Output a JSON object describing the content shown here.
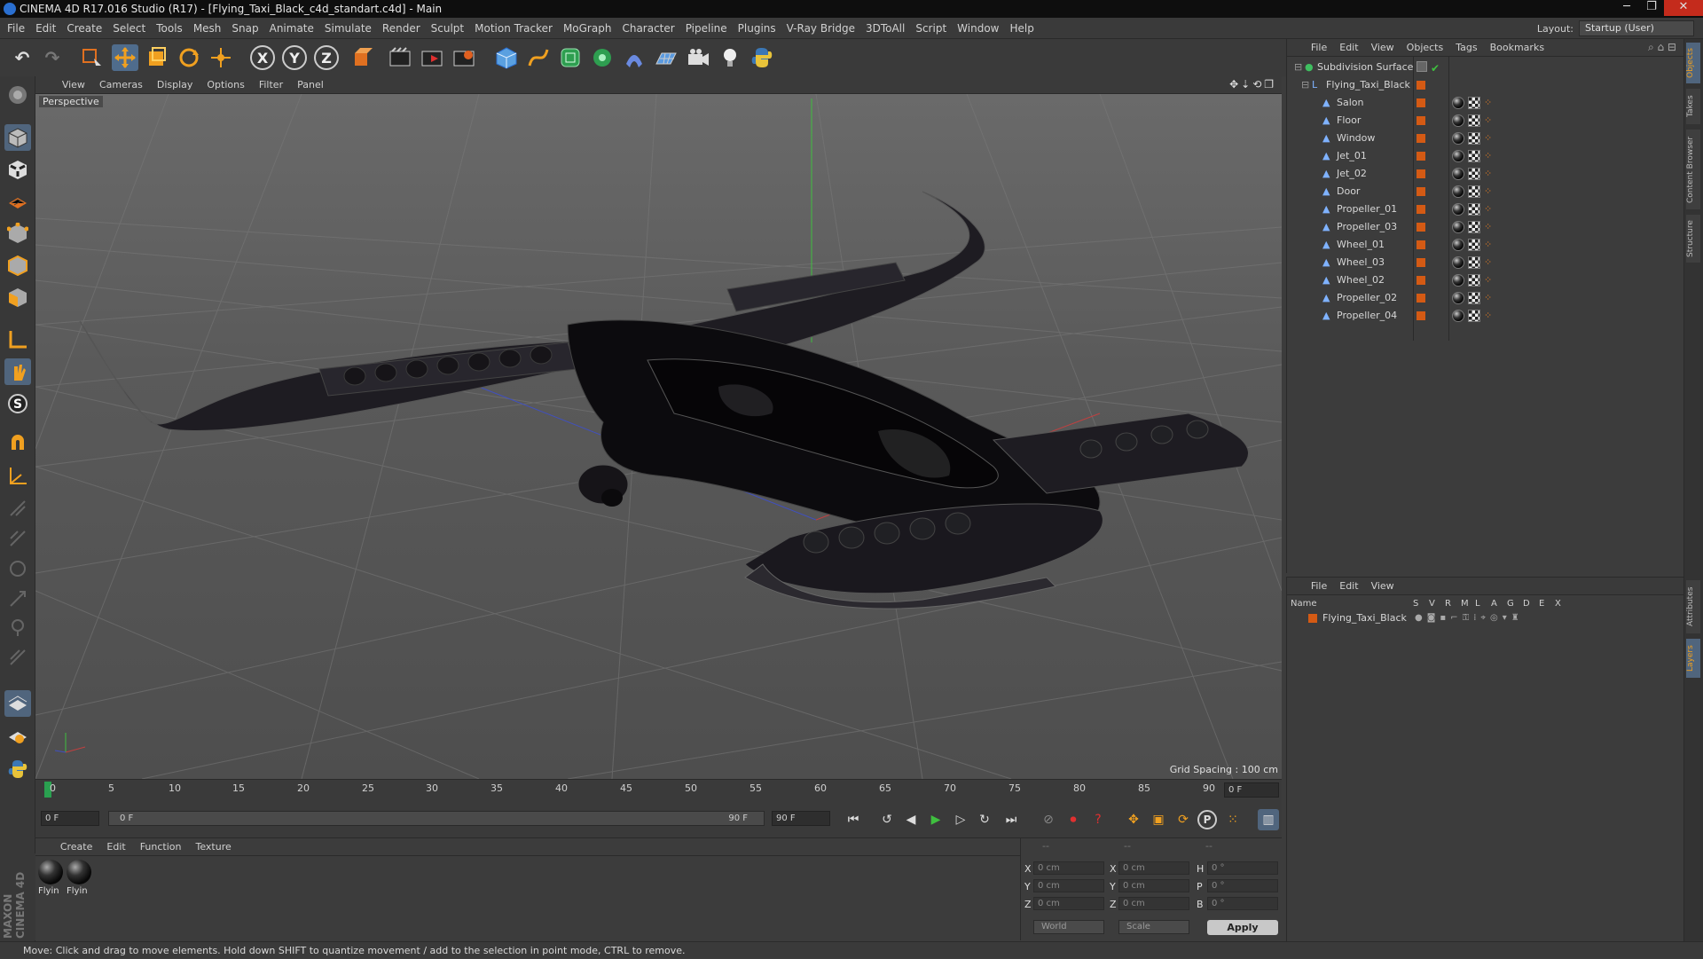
{
  "window": {
    "title": "CINEMA 4D R17.016 Studio (R17) - [Flying_Taxi_Black_c4d_standart.c4d] - Main",
    "controls": [
      "─",
      "❐",
      "✕"
    ]
  },
  "menubar": {
    "items": [
      "File",
      "Edit",
      "Create",
      "Select",
      "Tools",
      "Mesh",
      "Snap",
      "Animate",
      "Simulate",
      "Render",
      "Sculpt",
      "Motion Tracker",
      "MoGraph",
      "Character",
      "Pipeline",
      "Plugins",
      "V-Ray Bridge",
      "3DToAll",
      "Script",
      "Window",
      "Help"
    ],
    "layout_label": "Layout:",
    "layout_value": "Startup (User)"
  },
  "toolbar": {
    "axis_x": "X",
    "axis_y": "Y",
    "axis_z": "Z"
  },
  "viewport": {
    "menu": [
      "View",
      "Cameras",
      "Display",
      "Options",
      "Filter",
      "Panel"
    ],
    "label": "Perspective",
    "grid_spacing": "Grid Spacing : 100 cm"
  },
  "timeline": {
    "ticks": [
      "0",
      "5",
      "10",
      "15",
      "20",
      "25",
      "30",
      "35",
      "40",
      "45",
      "50",
      "55",
      "60",
      "65",
      "70",
      "75",
      "80",
      "85",
      "90"
    ],
    "end_frame_display": "0 F",
    "current_frame": "0 F",
    "range_start": "0 F",
    "range_end": "90 F",
    "max_frame": "90 F"
  },
  "material_manager": {
    "menu": [
      "Create",
      "Edit",
      "Function",
      "Texture"
    ],
    "materials": [
      "Flyin",
      "Flyin"
    ]
  },
  "coordinates": {
    "headers": [
      "--",
      "--",
      "--"
    ],
    "rows": [
      {
        "pos_label": "X",
        "pos": "0 cm",
        "size_label": "X",
        "size": "0 cm",
        "rot_label": "H",
        "rot": "0 °"
      },
      {
        "pos_label": "Y",
        "pos": "0 cm",
        "size_label": "Y",
        "size": "0 cm",
        "rot_label": "P",
        "rot": "0 °"
      },
      {
        "pos_label": "Z",
        "pos": "0 cm",
        "size_label": "Z",
        "size": "0 cm",
        "rot_label": "B",
        "rot": "0 °"
      }
    ],
    "mode": "World",
    "type": "Scale",
    "apply": "Apply"
  },
  "object_manager": {
    "menu": [
      "File",
      "Edit",
      "View",
      "Objects",
      "Tags",
      "Bookmarks"
    ],
    "root": "Subdivision Surface",
    "group": "Flying_Taxi_Black",
    "objects": [
      "Salon",
      "Floor",
      "Window",
      "Jet_01",
      "Jet_02",
      "Door",
      "Propeller_01",
      "Propeller_03",
      "Wheel_01",
      "Wheel_03",
      "Wheel_02",
      "Propeller_02",
      "Propeller_04"
    ],
    "layer_color": "#d45a14"
  },
  "layer_manager": {
    "menu": [
      "File",
      "Edit",
      "View"
    ],
    "columns": [
      "Name",
      "S",
      "V",
      "R",
      "M",
      "L",
      "A",
      "G",
      "D",
      "E",
      "X"
    ],
    "layers": [
      "Flying_Taxi_Black"
    ]
  },
  "right_tabs": [
    "Objects",
    "Takes",
    "Content Browser",
    "Structure",
    "Attributes",
    "Layers"
  ],
  "branding": "MAXON CINEMA 4D",
  "status": "Move: Click and drag to move elements. Hold down SHIFT to quantize movement / add to the selection in point mode, CTRL to remove."
}
